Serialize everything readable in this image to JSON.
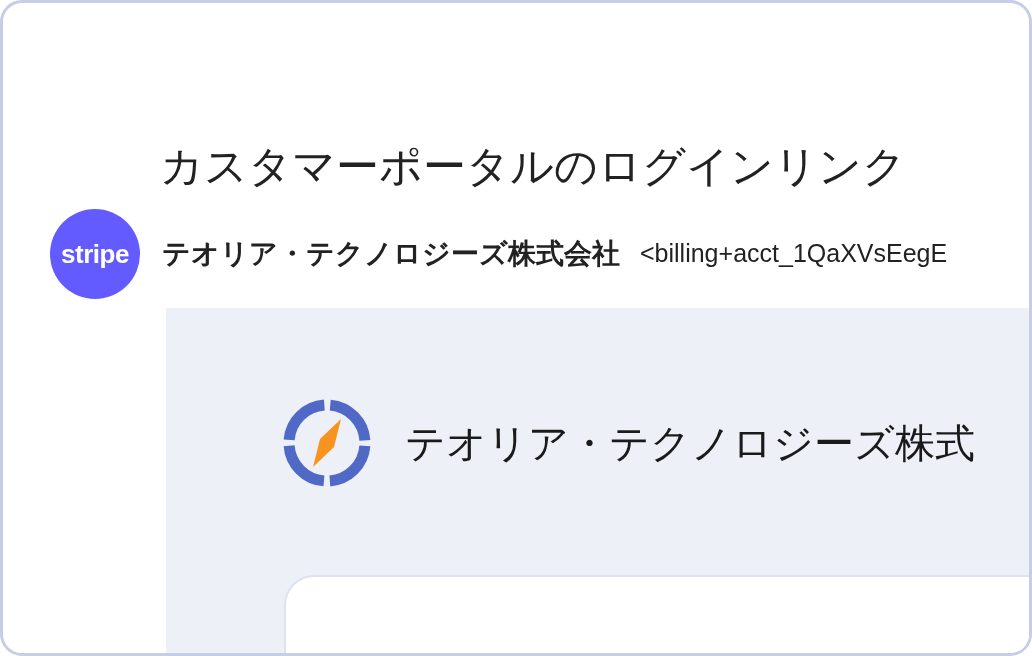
{
  "email": {
    "subject": "カスタマーポータルのログインリンク",
    "sender": {
      "avatar_text": "stripe",
      "name": "テオリア・テクノロジーズ株式会社",
      "address": "<billing+acct_1QaXVsEegE"
    },
    "body_preview": {
      "brand_name": "テオリア・テクノロジーズ株式"
    }
  }
}
